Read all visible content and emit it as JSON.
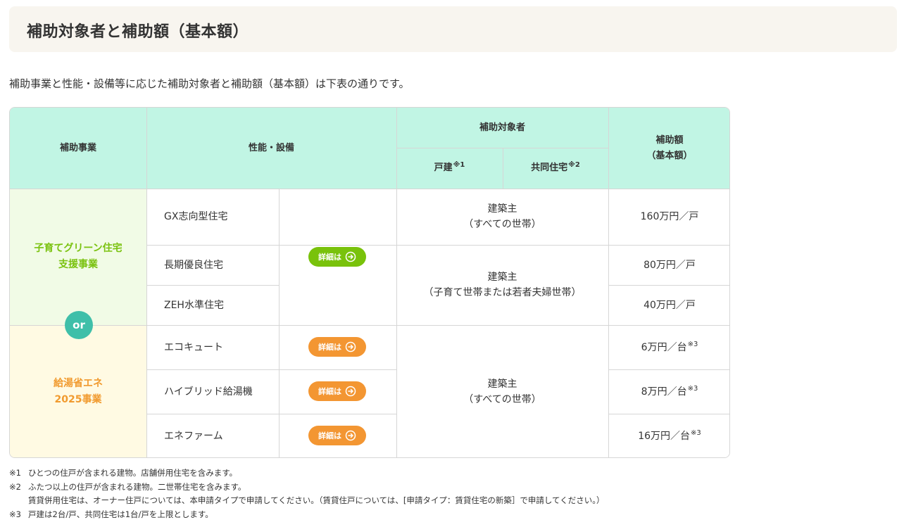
{
  "heading": "補助対象者と補助額（基本額）",
  "intro": "補助事業と性能・設備等に応じた補助対象者と補助額（基本額）は下表の通りです。",
  "table": {
    "headers": {
      "program": "補助事業",
      "performance": "性能・設備",
      "target": "補助対象者",
      "detached": "戸建",
      "detached_note": "※1",
      "collective": "共同住宅",
      "collective_note": "※2",
      "amount_line1": "補助額",
      "amount_line2": "（基本額）"
    },
    "programs": {
      "green_line1": "子育てグリーン住宅",
      "green_line2": "支援事業",
      "or": "or",
      "energy_line1": "給湯省エネ",
      "energy_line2": "2025事業"
    },
    "rows": [
      {
        "item": "GX志向型住宅",
        "amount": "160万円／戸",
        "amount_note": ""
      },
      {
        "item": "長期優良住宅",
        "amount": "80万円／戸",
        "amount_note": ""
      },
      {
        "item": "ZEH水準住宅",
        "amount": "40万円／戸",
        "amount_note": ""
      },
      {
        "item": "エコキュート",
        "amount": "6万円／台",
        "amount_note": "※3"
      },
      {
        "item": "ハイブリッド給湯機",
        "amount": "8万円／台",
        "amount_note": "※3"
      },
      {
        "item": "エネファーム",
        "amount": "16万円／台",
        "amount_note": "※3"
      }
    ],
    "targets": {
      "gx_line1": "建築主",
      "gx_line2": "（すべての世帯）",
      "long_line1": "建築主",
      "long_line2": "（子育て世帯または若者夫婦世帯）",
      "water_line1": "建築主",
      "water_line2": "（すべての世帯）"
    },
    "detail_button": "詳細は",
    "colors": {
      "green_button": "#79c20b",
      "orange_button": "#f39632",
      "header_bg": "#c1f5e4",
      "or_badge": "#3fbfa9"
    }
  },
  "notes": [
    {
      "mark": "※1",
      "text": "ひとつの住戸が含まれる建物。店舗併用住宅を含みます。"
    },
    {
      "mark": "※2",
      "text": "ふたつ以上の住戸が含まれる建物。二世帯住宅を含みます。"
    },
    {
      "mark": "",
      "text": "賃貸併用住宅は、オーナー住戸については、本申請タイプで申請してください。（賃貸住戸については、[申請タイプ：賃貸住宅の新築］で申請してください。）"
    },
    {
      "mark": "※3",
      "text": "戸建は2台/戸、共同住宅は1台/戸を上限とします。"
    }
  ]
}
